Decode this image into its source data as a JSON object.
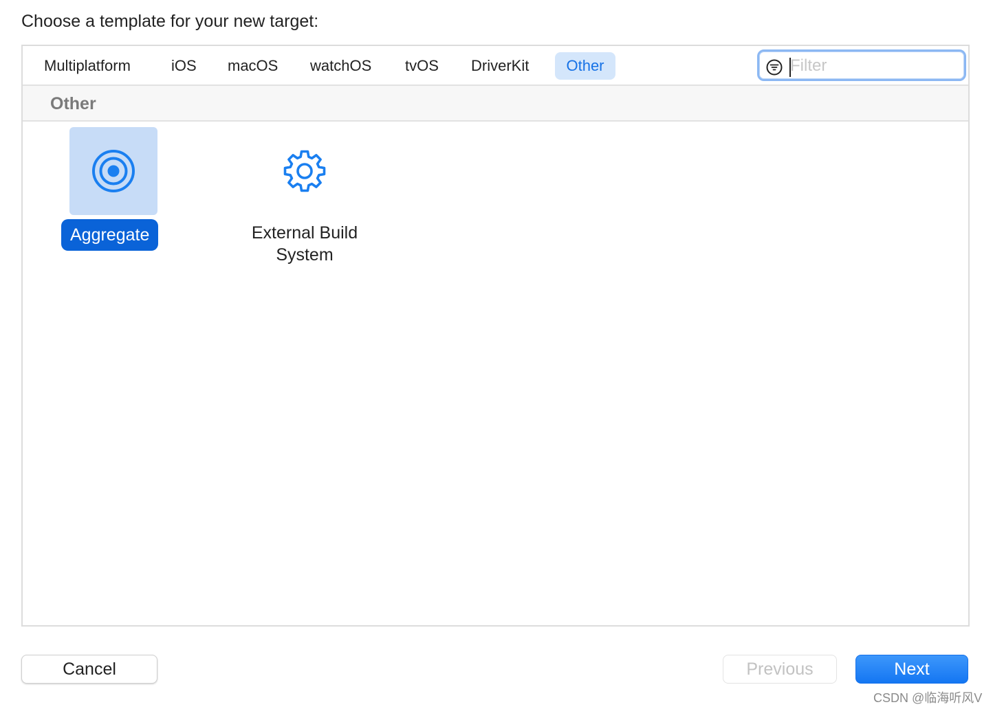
{
  "dialog": {
    "heading": "Choose a template for your new target:"
  },
  "tabs": [
    {
      "label": "Multiplatform",
      "selected": false
    },
    {
      "label": "iOS",
      "selected": false
    },
    {
      "label": "macOS",
      "selected": false
    },
    {
      "label": "watchOS",
      "selected": false
    },
    {
      "label": "tvOS",
      "selected": false
    },
    {
      "label": "DriverKit",
      "selected": false
    },
    {
      "label": "Other",
      "selected": true
    }
  ],
  "filter": {
    "placeholder": "Filter",
    "value": "",
    "icon": "filter-circle-icon"
  },
  "section": {
    "title": "Other"
  },
  "templates": [
    {
      "label": "Aggregate",
      "icon": "target-icon",
      "selected": true
    },
    {
      "label": "External Build System",
      "label_line1": "External Build",
      "label_line2": "System",
      "icon": "gear-icon",
      "selected": false
    }
  ],
  "buttons": {
    "cancel": "Cancel",
    "previous": "Previous",
    "next": "Next"
  },
  "watermark": "CSDN @临海听风V",
  "colors": {
    "accent": "#0a63d8",
    "selected_tab_bg": "#d4e6fb",
    "selected_tile_bg": "#c7dcf7",
    "icon_blue": "#1a7ff0"
  }
}
